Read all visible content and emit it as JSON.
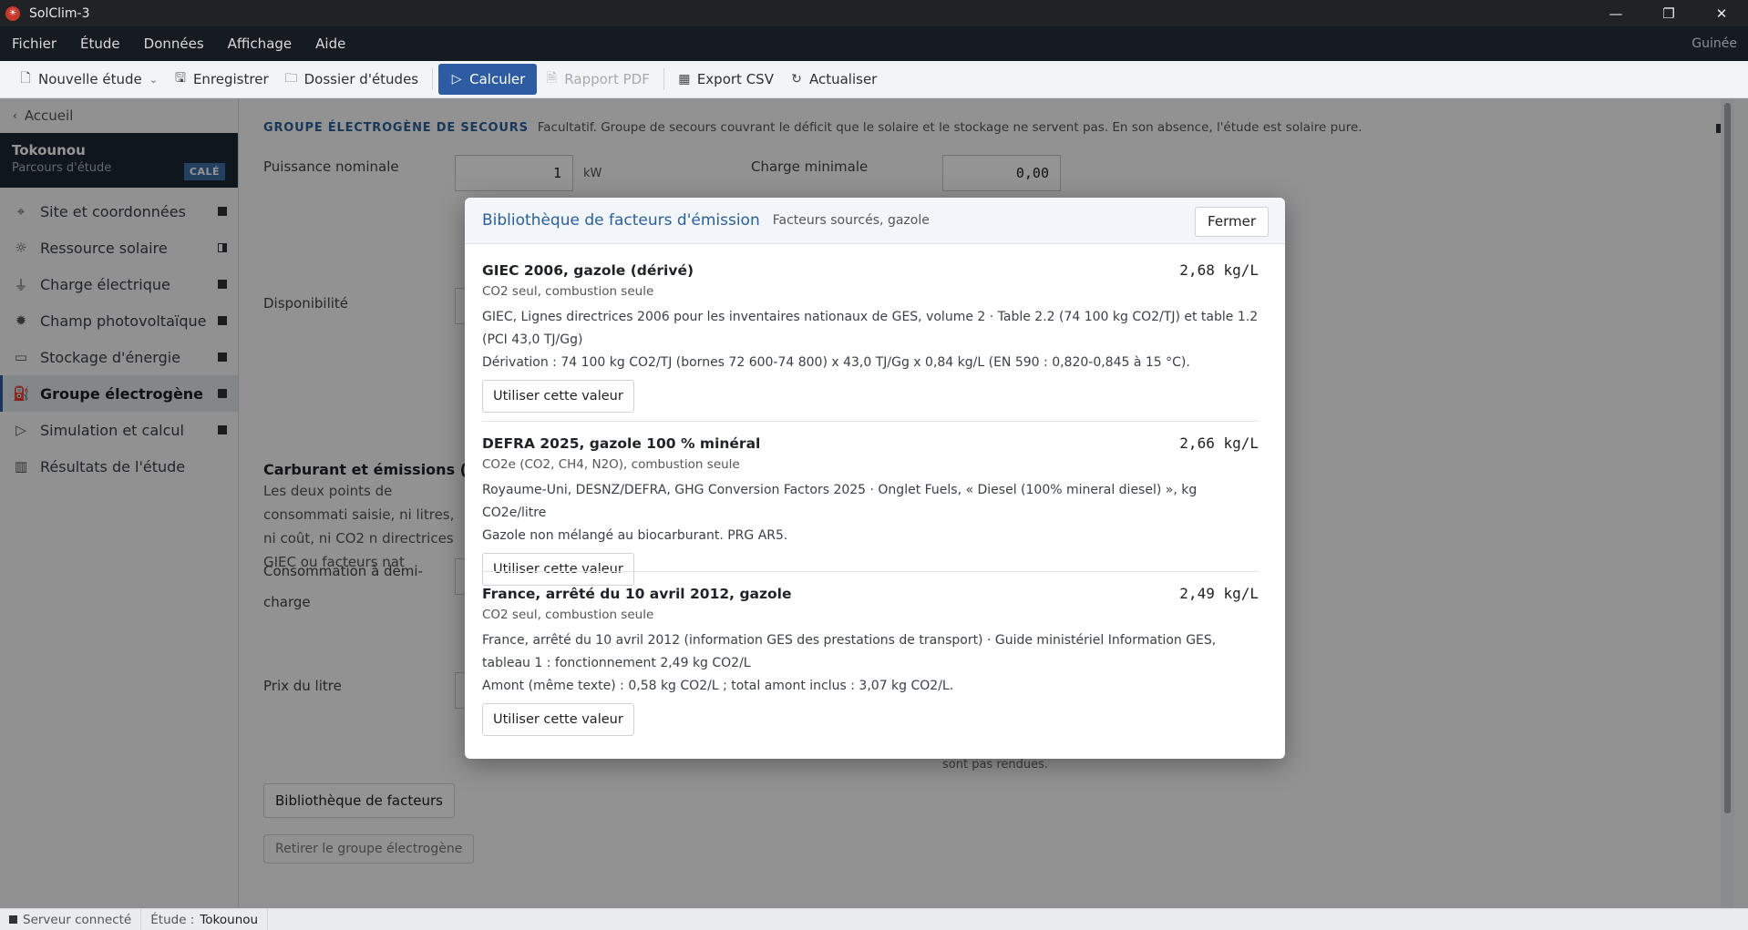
{
  "window": {
    "title": "SolClim-3",
    "icon": "sun-app-icon"
  },
  "menubar": {
    "items": [
      "Fichier",
      "Étude",
      "Données",
      "Affichage",
      "Aide"
    ],
    "region": "Guinée"
  },
  "toolbar": {
    "new_study": "Nouvelle étude",
    "save": "Enregistrer",
    "folder": "Dossier d'études",
    "calculate": "Calculer",
    "pdf": "Rapport PDF",
    "csv": "Export CSV",
    "refresh": "Actualiser"
  },
  "sidebar": {
    "back": "Accueil",
    "study_name": "Tokounou",
    "study_sub": "Parcours d'étude",
    "badge": "CALÉ",
    "items": [
      {
        "label": "Site et coordonnées",
        "status": "full"
      },
      {
        "label": "Ressource solaire",
        "status": "half"
      },
      {
        "label": "Charge électrique",
        "status": "full"
      },
      {
        "label": "Champ photovoltaïque",
        "status": "full"
      },
      {
        "label": "Stockage d'énergie",
        "status": "full"
      },
      {
        "label": "Groupe électrogène",
        "status": "full"
      },
      {
        "label": "Simulation et calcul",
        "status": "full"
      },
      {
        "label": "Résultats de l'étude",
        "status": "none"
      }
    ]
  },
  "main": {
    "section_caption": "GROUPE ÉLECTROGÈNE DE SECOURS",
    "section_desc": "Facultatif. Groupe de secours couvrant le déficit que le solaire et le stockage ne servent pas. En son absence, l'étude est solaire pure.",
    "nominal_power_label": "Puissance nominale",
    "nominal_power_value": "1",
    "nominal_power_unit": "kW",
    "min_load_label": "Charge minimale",
    "min_load_value": "0,00",
    "availability_label": "Disponibilité",
    "fuel_heading": "Carburant et émissions (optio",
    "fuel_para": "Les deux points de consommati saisie, ni litres, ni coût, ni CO2 n directrices GIEC ou facteurs nat",
    "half_load_label_1": "Consommation à demi-",
    "half_load_label_2": "charge",
    "liter_price_label": "Prix du litre",
    "note_bottom": "sont pas rendues.",
    "library_button": "Bibliothèque de facteurs",
    "remove_button": "Retirer le groupe électrogène"
  },
  "modal": {
    "title": "Bibliothèque de facteurs d'émission",
    "subtitle": "Facteurs sourcés, gazole",
    "close": "Fermer",
    "use_label": "Utiliser cette valeur",
    "factors": [
      {
        "name": "GIEC 2006, gazole (dérivé)",
        "value": "2,68 kg/L",
        "scope": "CO2 seul, combustion seule",
        "source": "GIEC, Lignes directrices 2006 pour les inventaires nationaux de GES, volume 2 · Table 2.2 (74 100 kg CO2/TJ) et table 1.2 (PCI 43,0 TJ/Gg)",
        "derivation": "Dérivation : 74 100 kg CO2/TJ (bornes 72 600-74 800) x 43,0 TJ/Gg x 0,84 kg/L (EN 590 : 0,820-0,845 à 15 °C)."
      },
      {
        "name": "DEFRA 2025, gazole 100 % minéral",
        "value": "2,66 kg/L",
        "scope": "CO2e (CO2, CH4, N2O), combustion seule",
        "source": "Royaume-Uni, DESNZ/DEFRA, GHG Conversion Factors 2025 · Onglet Fuels, « Diesel (100% mineral diesel) », kg CO2e/litre",
        "derivation": "Gazole non mélangé au biocarburant. PRG AR5."
      },
      {
        "name": "France, arrêté du 10 avril 2012, gazole",
        "value": "2,49 kg/L",
        "scope": "CO2 seul, combustion seule",
        "source": "France, arrêté du 10 avril 2012 (information GES des prestations de transport) · Guide ministériel Information GES, tableau 1 : fonctionnement 2,49 kg CO2/L",
        "derivation": "Amont (même texte) : 0,58 kg CO2/L ; total amont inclus : 3,07 kg CO2/L."
      }
    ]
  },
  "statusbar": {
    "server": "Serveur connecté",
    "study_label": "Étude :",
    "study_value": "Tokounou"
  }
}
